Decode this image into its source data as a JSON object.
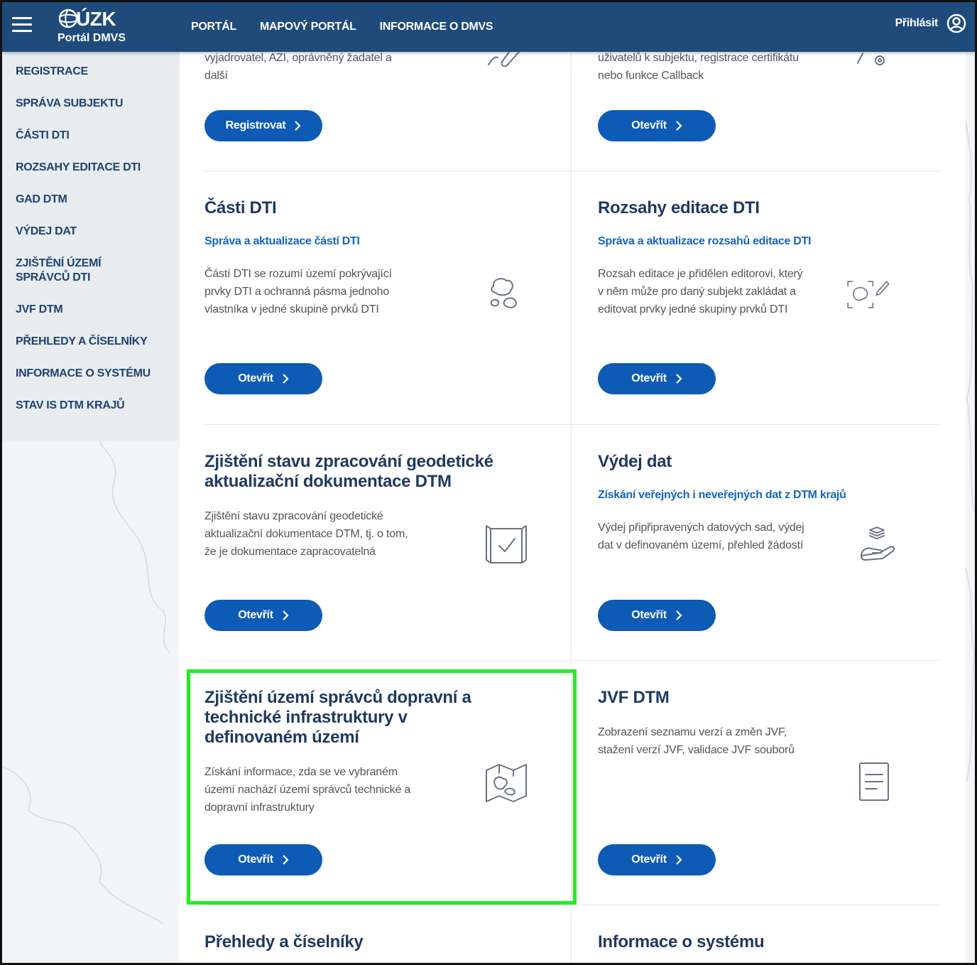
{
  "header": {
    "logo_text": "ÚZK",
    "logo_sub": "Portál DMVS",
    "nav": [
      "PORTÁL",
      "MAPOVÝ PORTÁL",
      "INFORMACE O DMVS"
    ],
    "login": "Přihlásit"
  },
  "sidebar": {
    "items": [
      "REGISTRACE",
      "SPRÁVA SUBJEKTU",
      "ČÁSTI DTI",
      "ROZSAHY EDITACE DTI",
      "GAD DTM",
      "VÝDEJ DAT",
      "ZJIŠTĚNÍ ÚZEMÍ SPRÁVCŮ DTI",
      "JVF DTM",
      "PŘEHLEDY A ČÍSELNÍKY",
      "INFORMACE O SYSTÉMU",
      "STAV IS DTM KRAJŮ"
    ]
  },
  "cards": {
    "registrace": {
      "desc": "vyjadrovatel, AZI, oprávněný žadatel a další",
      "button": "Registrovat"
    },
    "sprava": {
      "desc": "uživatelů k subjektu, registrace certifikátu nebo funkce Callback",
      "button": "Otevřít"
    },
    "casti": {
      "title": "Části DTI",
      "subtitle": "Správa a aktualizace částí DTI",
      "desc": "Částí DTI se rozumí území pokrývající prvky DTI a ochranná pásma jednoho vlastníka v jedné skupině prvků DTI",
      "button": "Otevřít"
    },
    "rozsahy": {
      "title": "Rozsahy editace DTI",
      "subtitle": "Správa a aktualizace rozsahů editace DTI",
      "desc": "Rozsah editace je přidělen editorovi, který v něm může pro daný subjekt zakládat a editovat prvky jedné skupiny prvků DTI",
      "button": "Otevřít"
    },
    "gad": {
      "title": "Zjištění stavu zpracování geodetické aktualizační dokumentace DTM",
      "desc": "Zjištění stavu zpracování geodetické aktualizační dokumentace DTM, tj. o tom, že je dokumentace zapracovatelná",
      "button": "Otevřít"
    },
    "vydej": {
      "title": "Výdej dat",
      "subtitle": "Získání veřejných i neveřejných dat z DTM krajů",
      "desc": "Výdej připřipravených datových sad, výdej dat v definovaném území, přehled žádostí",
      "button": "Otevřít"
    },
    "zjisteni": {
      "title": "Zjištění území správců dopravní a technické infrastruktury v definovaném území",
      "desc": "Získání informace, zda se ve vybraném území nachází území správců technické a dopravní infrastruktury",
      "button": "Otevřít"
    },
    "jvf": {
      "title": "JVF DTM",
      "desc": "Zobrazení seznamu verzí a změn JVF, stažení verzí JVF, validace JVF souborů",
      "button": "Otevřít"
    },
    "prehledy": {
      "title": "Přehledy a číselníky"
    },
    "informace": {
      "title": "Informace o systému"
    }
  },
  "colors": {
    "header_bg": "#1f4b7a",
    "button_bg": "#0d5bb5",
    "link": "#1565c0",
    "highlight": "#22ee22"
  }
}
